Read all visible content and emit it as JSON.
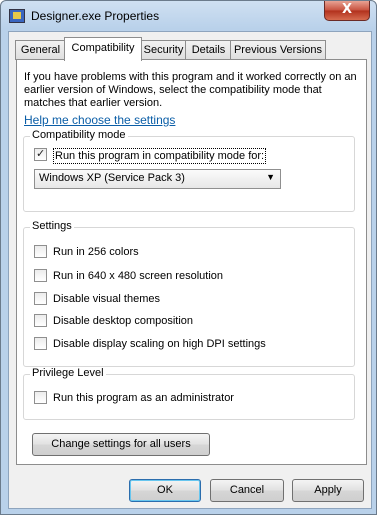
{
  "window": {
    "title": "Designer.exe Properties",
    "close_label": "X"
  },
  "tabs": [
    {
      "label": "General"
    },
    {
      "label": "Compatibility"
    },
    {
      "label": "Security"
    },
    {
      "label": "Details"
    },
    {
      "label": "Previous Versions"
    }
  ],
  "compatibility": {
    "intro_text": "If you have problems with this program and it worked correctly on an earlier version of Windows, select the compatibility mode that matches that earlier version.",
    "help_link": "Help me choose the settings",
    "mode_group": {
      "title": "Compatibility mode",
      "checkbox_label": "Run this program in compatibility mode for:",
      "checked": true,
      "selected_os": "Windows XP (Service Pack 3)"
    },
    "settings_group": {
      "title": "Settings",
      "options": [
        {
          "label": "Run in 256 colors",
          "checked": false
        },
        {
          "label": "Run in 640 x 480 screen resolution",
          "checked": false
        },
        {
          "label": "Disable visual themes",
          "checked": false
        },
        {
          "label": "Disable desktop composition",
          "checked": false
        },
        {
          "label": "Disable display scaling on high DPI settings",
          "checked": false
        }
      ]
    },
    "privilege_group": {
      "title": "Privilege Level",
      "admin_label": "Run this program as an administrator",
      "checked": false
    },
    "change_all_users_label": "Change settings for all users"
  },
  "footer": {
    "ok_label": "OK",
    "cancel_label": "Cancel",
    "apply_label": "Apply"
  },
  "icons": {
    "window": "application-icon",
    "close": "close-icon",
    "dropdown": "chevron-down-icon",
    "check": "checkmark-icon"
  }
}
